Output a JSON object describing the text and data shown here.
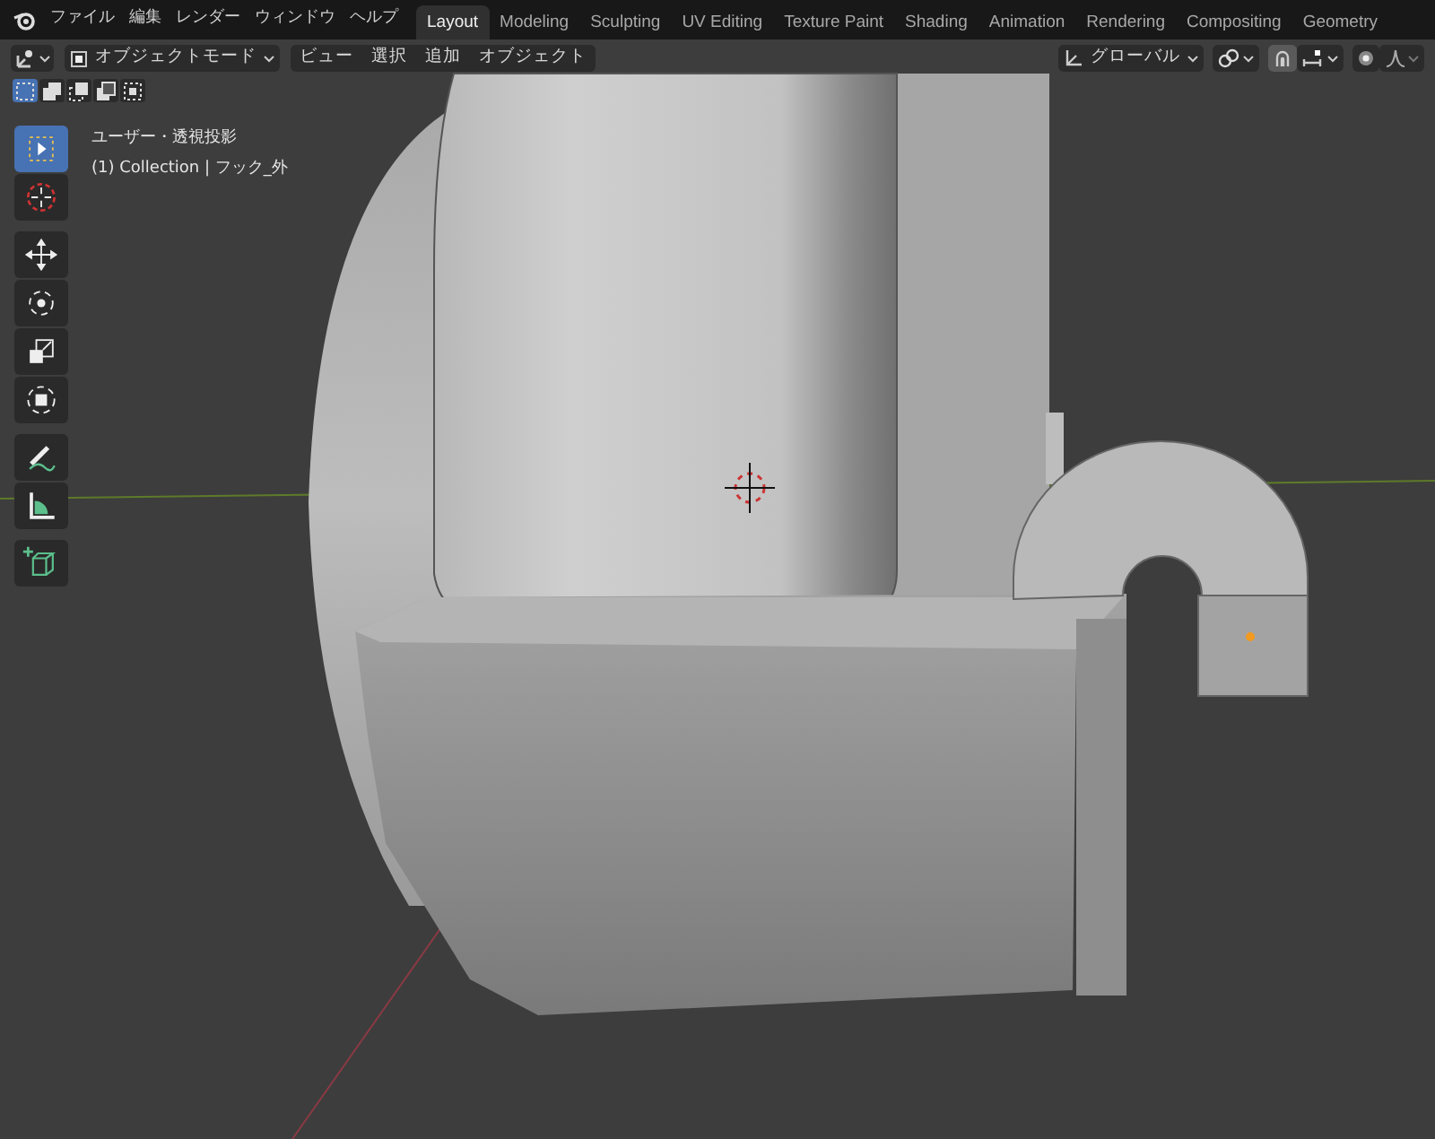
{
  "menu_bar": {
    "items": [
      "ファイル",
      "編集",
      "レンダー",
      "ウィンドウ",
      "ヘルプ"
    ]
  },
  "workspace_tabs": [
    {
      "label": "Layout",
      "selected": true
    },
    {
      "label": "Modeling",
      "selected": false
    },
    {
      "label": "Sculpting",
      "selected": false
    },
    {
      "label": "UV Editing",
      "selected": false
    },
    {
      "label": "Texture Paint",
      "selected": false
    },
    {
      "label": "Shading",
      "selected": false
    },
    {
      "label": "Animation",
      "selected": false
    },
    {
      "label": "Rendering",
      "selected": false
    },
    {
      "label": "Compositing",
      "selected": false
    },
    {
      "label": "Geometry",
      "selected": false
    }
  ],
  "viewport_header": {
    "mode": "オブジェクトモード",
    "menus": [
      "ビュー",
      "選択",
      "追加",
      "オブジェクト"
    ],
    "orientation": "グローバル",
    "snap": true,
    "proportional_editing": false
  },
  "select_modes": [
    {
      "kind": "set",
      "selected": true
    },
    {
      "kind": "extend",
      "selected": false
    },
    {
      "kind": "subtract",
      "selected": false
    },
    {
      "kind": "invert",
      "selected": false
    },
    {
      "kind": "intersect",
      "selected": false
    }
  ],
  "tools": [
    {
      "kind": "select",
      "selected": true
    },
    {
      "kind": "cursor",
      "selected": false
    },
    {
      "kind": "move",
      "selected": false
    },
    {
      "kind": "rotate",
      "selected": false
    },
    {
      "kind": "scale",
      "selected": false
    },
    {
      "kind": "transform",
      "selected": false
    },
    {
      "kind": "annotate",
      "selected": false
    },
    {
      "kind": "measure",
      "selected": false
    },
    {
      "kind": "add-cube",
      "selected": false
    }
  ],
  "viewport_overlay": {
    "view": "ユーザー・透視投影",
    "object": "(1) Collection | フック_外"
  }
}
